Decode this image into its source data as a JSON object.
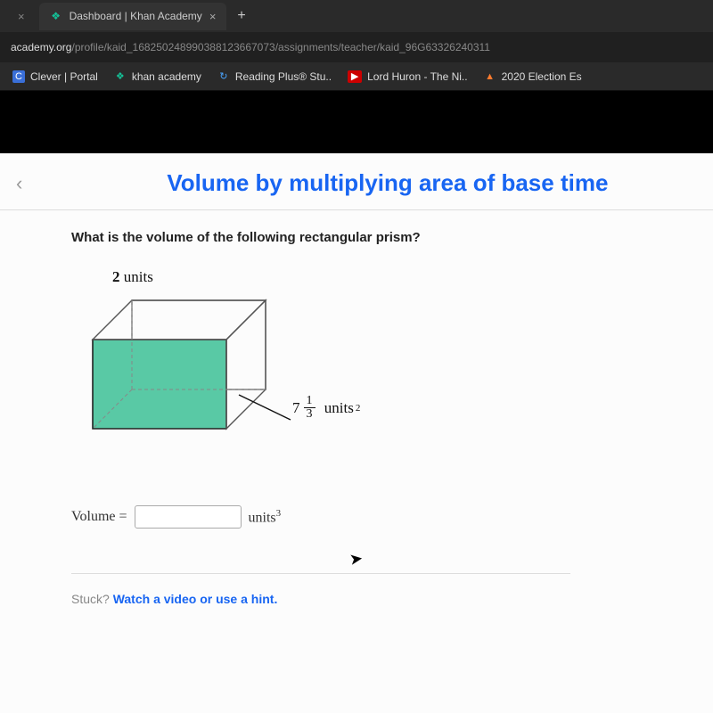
{
  "browser": {
    "tabs": [
      {
        "title": ""
      },
      {
        "title": "Dashboard | Khan Academy"
      }
    ],
    "new_tab_glyph": "+",
    "close_glyph": "×",
    "url_domain": "academy.org",
    "url_path": "/profile/kaid_168250248990388123667073/assignments/teacher/kaid_96G63326240311"
  },
  "bookmarks": [
    {
      "label": "Clever | Portal",
      "icon": "C",
      "icon_name": "clever-icon"
    },
    {
      "label": "khan academy",
      "icon": "❖",
      "icon_name": "khan-icon"
    },
    {
      "label": "Reading Plus® Stu..",
      "icon": "↻",
      "icon_name": "reading-icon"
    },
    {
      "label": "Lord Huron - The Ni..",
      "icon": "▶",
      "icon_name": "youtube-icon"
    },
    {
      "label": "2020 Election Es",
      "icon": "▲",
      "icon_name": "election-icon"
    }
  ],
  "page": {
    "back_glyph": "‹",
    "title": "Volume by multiplying area of base time"
  },
  "question": {
    "prompt": "What is the volume of the following rectangular prism?",
    "dim_length_value": "2",
    "dim_length_unit": "units",
    "base_area_whole": "7",
    "base_area_num": "1",
    "base_area_den": "3",
    "base_area_unit": "units",
    "base_area_exp": "2",
    "answer_label": "Volume =",
    "answer_unit": "units",
    "answer_exp": "3",
    "answer_value": "",
    "stuck_prefix": "Stuck? ",
    "stuck_link": "Watch a video or use a hint."
  }
}
